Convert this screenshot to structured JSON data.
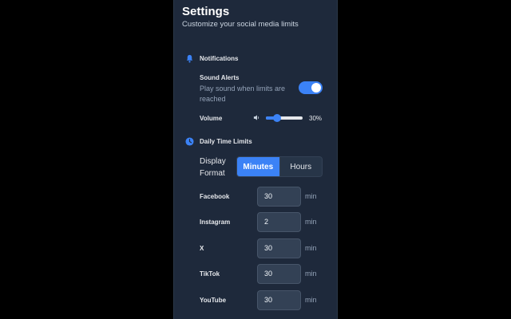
{
  "header": {
    "title": "Settings",
    "subtitle": "Customize your social media limits"
  },
  "notifications": {
    "heading": "Notifications",
    "icon": "bell-icon",
    "sound_alerts": {
      "label": "Sound Alerts",
      "description": "Play sound when limits are reached",
      "enabled": true
    },
    "volume": {
      "label": "Volume",
      "icon": "speaker-icon",
      "value_fraction": 0.3,
      "value_text": "30%"
    }
  },
  "time_limits": {
    "heading": "Daily Time Limits",
    "icon": "clock-icon",
    "display_format": {
      "label": "Display Format",
      "options": [
        "Minutes",
        "Hours"
      ],
      "selected": "Minutes"
    },
    "platforms": [
      {
        "name": "Facebook",
        "value": "30",
        "unit": "min"
      },
      {
        "name": "Instagram",
        "value": "2",
        "unit": "min"
      },
      {
        "name": "X",
        "value": "30",
        "unit": "min"
      },
      {
        "name": "TikTok",
        "value": "30",
        "unit": "min"
      },
      {
        "name": "YouTube",
        "value": "30",
        "unit": "min"
      }
    ]
  },
  "colors": {
    "accent": "#3b82f6",
    "panel_bg": "#1e293b",
    "input_bg": "#334155"
  }
}
